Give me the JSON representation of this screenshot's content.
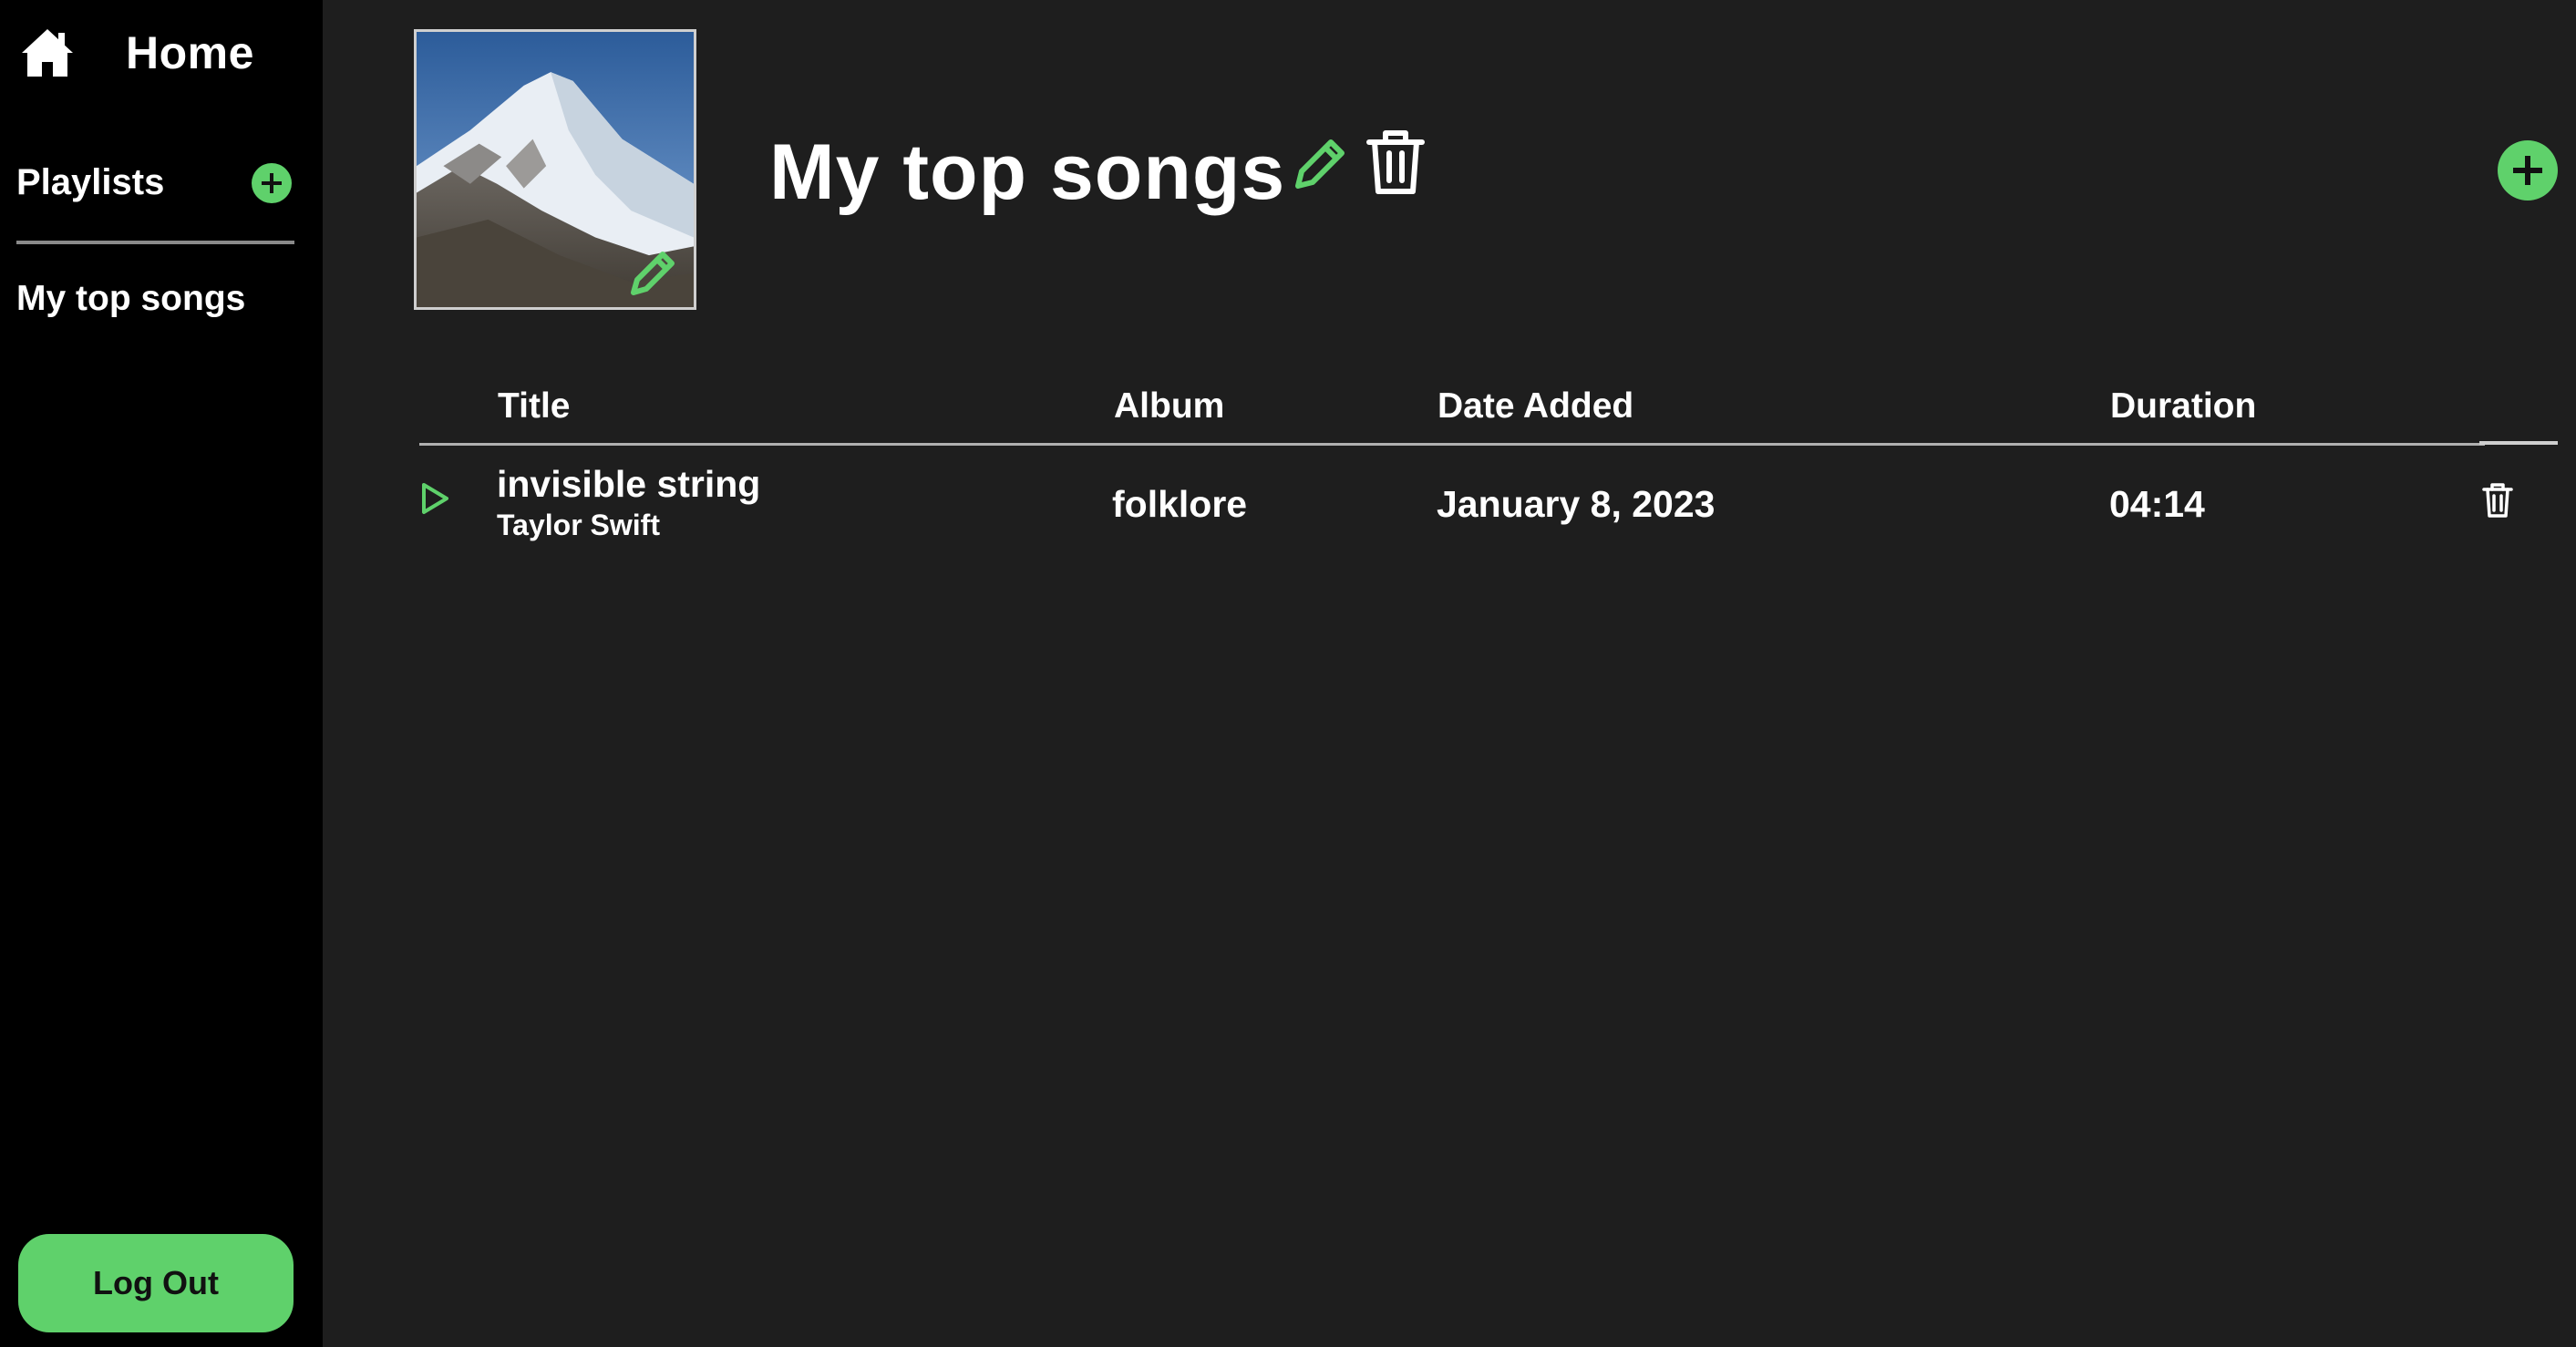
{
  "sidebar": {
    "home_label": "Home",
    "playlists_label": "Playlists",
    "playlists": [
      "My top songs"
    ],
    "logout_label": "Log Out"
  },
  "playlist": {
    "title": "My top songs"
  },
  "table": {
    "headers": {
      "title": "Title",
      "album": "Album",
      "date_added": "Date Added",
      "duration": "Duration"
    },
    "rows": [
      {
        "title": "invisible string",
        "artist": "Taylor Swift",
        "album": "folklore",
        "date_added": "January 8, 2023",
        "duration": "04:14"
      }
    ]
  },
  "icons": {
    "home": "home-icon",
    "add": "plus-icon",
    "edit": "pencil-icon",
    "delete": "trash-icon",
    "play": "play-icon"
  },
  "colors": {
    "accent": "#5fd16b",
    "sidebar_bg": "#000000",
    "main_bg": "#1e1e1e",
    "text": "#ffffff"
  }
}
